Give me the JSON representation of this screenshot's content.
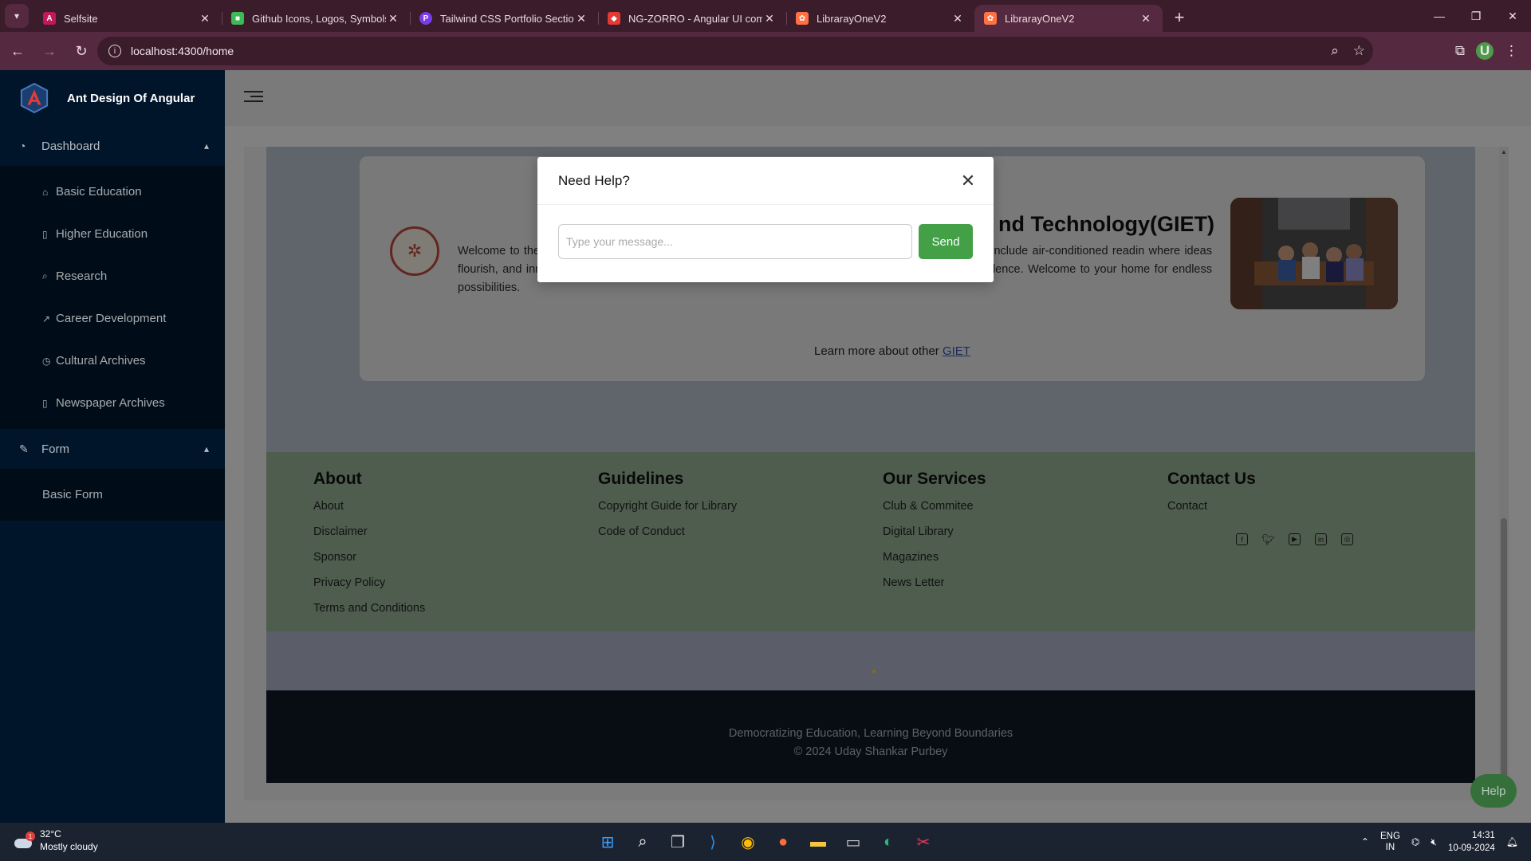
{
  "browser": {
    "tabs": [
      {
        "title": "Selfsite",
        "favicon_color": "#c2185b"
      },
      {
        "title": "Github Icons, Logos, Symbols –",
        "favicon_color": "#3cba54"
      },
      {
        "title": "Tailwind CSS Portfolio Section |",
        "favicon_color": "#7c3aed"
      },
      {
        "title": "NG-ZORRO - Angular UI compo",
        "favicon_color": "#e53935"
      },
      {
        "title": "LibrarayOneV2",
        "favicon_color": "#ff7043"
      },
      {
        "title": "LibrarayOneV2",
        "favicon_color": "#ff7043",
        "active": true
      }
    ],
    "url": "localhost:4300/home",
    "profile_initial": "U"
  },
  "sidebar": {
    "brand": "Ant Design Of Angular",
    "dashboard_label": "Dashboard",
    "dashboard_items": [
      {
        "label": "Basic Education",
        "icon": "home-icon"
      },
      {
        "label": "Higher Education",
        "icon": "book-icon"
      },
      {
        "label": "Research",
        "icon": "search-icon"
      },
      {
        "label": "Career Development",
        "icon": "line-chart-icon"
      },
      {
        "label": "Cultural Archives",
        "icon": "history-icon"
      },
      {
        "label": "Newspaper Archives",
        "icon": "file-icon"
      }
    ],
    "form_label": "Form",
    "form_items": [
      {
        "label": "Basic Form"
      }
    ]
  },
  "main": {
    "card_title": "nd Technology(GIET)",
    "card_text": "Welcome to the G over 34,000 books, 559 educational CDs/DVDs, and acc r state-of-the-art facilities include air-conditioned readin where ideas flourish, and innovation thrives. Explore, discover, and grow with us at the forefront of academic excellence. Welcome to your home for endless possibilities.",
    "learn_more_prefix": "Learn more about other",
    "learn_more_link": "GIET"
  },
  "footer": {
    "columns": [
      {
        "heading": "About",
        "links": [
          "About",
          "Disclaimer",
          "Sponsor",
          "Privacy Policy",
          "Terms and Conditions"
        ]
      },
      {
        "heading": "Guidelines",
        "links": [
          "Copyright Guide for Library",
          "Code of Conduct"
        ]
      },
      {
        "heading": "Our Services",
        "links": [
          "Club & Commitee",
          "Digital Library",
          "Magazines",
          "News Letter"
        ]
      },
      {
        "heading": "Contact Us",
        "links": [
          "Contact"
        ]
      }
    ],
    "socials": [
      "facebook-icon",
      "twitter-icon",
      "youtube-icon",
      "linkedin-icon",
      "instagram-icon"
    ],
    "tagline": "Democratizing Education, Learning Beyond Boundaries",
    "copyright": "© 2024 Uday Shankar Purbey"
  },
  "modal": {
    "title": "Need Help?",
    "placeholder": "Type your message...",
    "send_label": "Send"
  },
  "help_button": "Help",
  "taskbar": {
    "temperature": "32°C",
    "weather": "Mostly cloudy",
    "weather_badge": "1",
    "lang_top": "ENG",
    "lang_bottom": "IN",
    "time": "14:31",
    "date": "10-09-2024"
  }
}
